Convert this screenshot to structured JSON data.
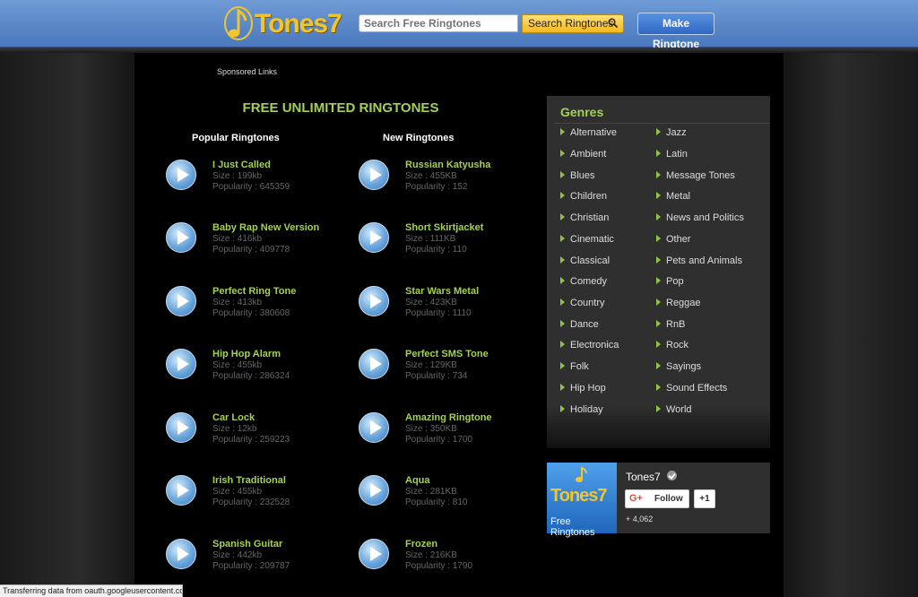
{
  "header": {
    "logo_text": "Tones7",
    "search_placeholder": "Search Free Ringtones",
    "search_button": "Search Ringtones",
    "make_button": "Make Ringtone"
  },
  "sponsored": "Sponsored Links",
  "main_title": "FREE UNLIMITED RINGTONES",
  "popular_heading": "Popular Ringtones",
  "new_heading": "New Ringtones",
  "popular": [
    {
      "title": "I Just Called",
      "size": "Size : 199kb",
      "popularity": "Popularity : 645359"
    },
    {
      "title": "Baby Rap New Version",
      "size": "Size : 416kb",
      "popularity": "Popularity : 409778"
    },
    {
      "title": "Perfect Ring Tone",
      "size": "Size : 413kb",
      "popularity": "Popularity : 380608"
    },
    {
      "title": "Hip Hop Alarm",
      "size": "Size : 455kb",
      "popularity": "Popularity : 286324"
    },
    {
      "title": "Car Lock",
      "size": "Size : 12kb",
      "popularity": "Popularity : 259223"
    },
    {
      "title": "Irish Traditional",
      "size": "Size : 455kb",
      "popularity": "Popularity : 232528"
    },
    {
      "title": "Spanish Guitar",
      "size": "Size : 442kb",
      "popularity": "Popularity : 209787"
    }
  ],
  "new": [
    {
      "title": "Russian Katyusha",
      "size": "Size : 455KB",
      "popularity": "Popularity : 152"
    },
    {
      "title": "Short Skirtjacket",
      "size": "Size : 111KB",
      "popularity": "Popularity : 110"
    },
    {
      "title": "Star Wars Metal",
      "size": "Size : 423KB",
      "popularity": "Popularity : 1110"
    },
    {
      "title": "Perfect SMS Tone",
      "size": "Size : 129KB",
      "popularity": "Popularity : 734"
    },
    {
      "title": "Amazing Ringtone",
      "size": "Size : 350KB",
      "popularity": "Popularity : 1700"
    },
    {
      "title": "Aqua",
      "size": "Size : 281KB",
      "popularity": "Popularity : 810"
    },
    {
      "title": "Frozen",
      "size": "Size : 216KB",
      "popularity": "Popularity : 1790"
    }
  ],
  "genres": {
    "title": "Genres",
    "left": [
      "Alternative",
      "Ambient",
      "Blues",
      "Children",
      "Christian",
      "Cinematic",
      "Classical",
      "Comedy",
      "Country",
      "Dance",
      "Electronica",
      "Folk",
      "Hip Hop",
      "Holiday"
    ],
    "right": [
      "Jazz",
      "Latin",
      "Message Tones",
      "Metal",
      "News and Politics",
      "Other",
      "Pets and Animals",
      "Pop",
      "Reggae",
      "RnB",
      "Rock",
      "Sayings",
      "Sound Effects",
      "World"
    ]
  },
  "social": {
    "logo_name": "Tones7",
    "logo_sub": "Free Ringtones",
    "page_name": "Tones7",
    "follow": "Follow",
    "gplus": "G+",
    "plus_one": "+1",
    "followers": "+ 4,062"
  },
  "status": "Transferring data from oauth.googleusercontent.com..."
}
